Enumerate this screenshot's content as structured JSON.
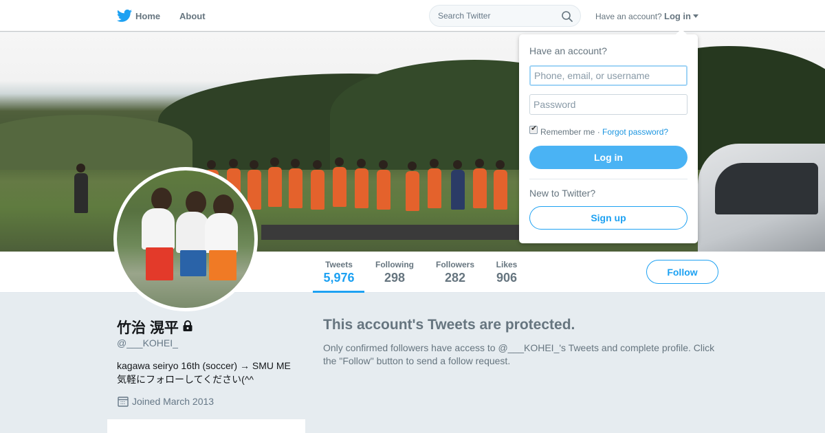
{
  "nav": {
    "home_label": "Home",
    "about_label": "About",
    "search_placeholder": "Search Twitter",
    "have_account": "Have an account?",
    "login_label": "Log in"
  },
  "profile": {
    "name": "竹治 滉平",
    "handle": "@___KOHEI_",
    "bio_line1": "kagawa seiryo 16th (soccer) → SMU ME",
    "bio_line2": "気軽にフォローしてください(^^",
    "joined": "Joined March 2013",
    "protected": true
  },
  "stats": [
    {
      "label": "Tweets",
      "value": "5,976"
    },
    {
      "label": "Following",
      "value": "298"
    },
    {
      "label": "Followers",
      "value": "282"
    },
    {
      "label": "Likes",
      "value": "906"
    }
  ],
  "follow_label": "Follow",
  "protected_notice": {
    "title": "This account's Tweets are protected.",
    "body": "Only confirmed followers have access to @___KOHEI_'s Tweets and complete profile. Click the \"Follow\" button to send a follow request."
  },
  "login_dropdown": {
    "title": "Have an account?",
    "username_placeholder": "Phone, email, or username",
    "password_placeholder": "Password",
    "remember_label": "Remember me ·",
    "remember_checked": true,
    "forgot_label": "Forgot password?",
    "login_button": "Log in",
    "new_label": "New to Twitter?",
    "signup_button": "Sign up"
  },
  "colors": {
    "accent": "#1da1f2",
    "login_button": "#4ab3f4",
    "muted_text": "#66757f",
    "page_background": "#e6ecf0"
  },
  "icons": [
    "twitter-bird-icon",
    "search-icon",
    "caret-down-icon",
    "lock-icon",
    "calendar-icon",
    "checkbox-check-icon"
  ]
}
